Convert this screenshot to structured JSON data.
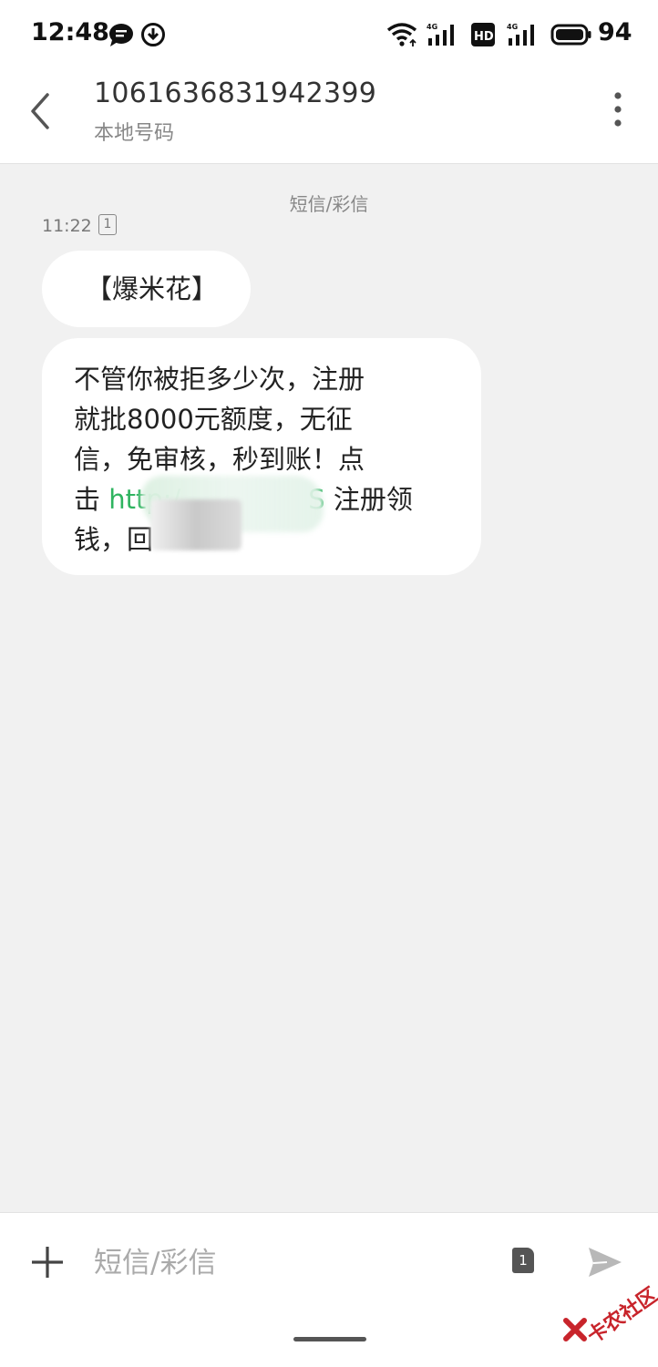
{
  "status_bar": {
    "time": "12:48",
    "battery": "94",
    "icons": [
      "message-icon",
      "download-icon",
      "wifi-icon",
      "signal-4g-icon",
      "hd-icon",
      "signal-4g-icon",
      "battery-icon"
    ],
    "network_label": "4G",
    "hd_label": "HD"
  },
  "header": {
    "contact_number": "1061636831942399",
    "contact_subtitle": "本地号码"
  },
  "conversation": {
    "channel_label": "短信/彩信",
    "message_time": "11:22",
    "sim_slot": "1",
    "messages": [
      {
        "text": "【爆米花】"
      },
      {
        "line1": "不管你被拒多少次，注册",
        "line2": "就批8000元额度，无征",
        "line3": "信，免审核，秒到账！点",
        "line4_prefix": "击 ",
        "line4_link": "http:/",
        "line4_link_tail": "S",
        "line4_suffix": " 注册领",
        "line5": "钱，回"
      }
    ]
  },
  "composer": {
    "placeholder": "短信/彩信",
    "sim_slot": "1"
  },
  "colors": {
    "link": "#2fb460",
    "background": "#f1f1f1",
    "bubble": "#ffffff",
    "watermark": "#c8242b"
  },
  "watermark": {
    "text": "卡农社区"
  }
}
